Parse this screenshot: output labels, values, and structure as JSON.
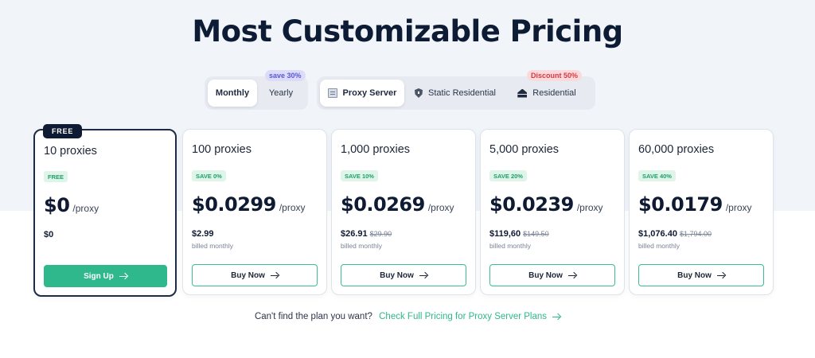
{
  "page": {
    "title": "Most Customizable Pricing"
  },
  "billing_toggle": {
    "options": [
      {
        "label": "Monthly",
        "active": true
      },
      {
        "label": "Yearly",
        "active": false
      }
    ],
    "badge": "save 30%"
  },
  "type_toggle": {
    "options": [
      {
        "label": "Proxy Server",
        "icon": "server-icon",
        "active": true
      },
      {
        "label": "Static Residential",
        "icon": "shield-icon",
        "active": false
      },
      {
        "label": "Residential",
        "icon": "home-icon",
        "active": false
      }
    ],
    "badge": "Discount 50%"
  },
  "plans": [
    {
      "tag": "FREE",
      "title": "10 proxies",
      "save": "FREE",
      "price": "$0",
      "unit": "/proxy",
      "total": "$0",
      "old": "",
      "billed": "",
      "button": "Sign Up"
    },
    {
      "title": "100 proxies",
      "save": "SAVE 0%",
      "price": "$0.0299",
      "unit": "/proxy",
      "total": "$2.99",
      "old": "",
      "billed": "billed monthly",
      "button": "Buy Now"
    },
    {
      "title": "1,000 proxies",
      "save": "SAVE 10%",
      "price": "$0.0269",
      "unit": "/proxy",
      "total": "$26.91",
      "old": "$29.90",
      "billed": "billed monthly",
      "button": "Buy Now"
    },
    {
      "title": "5,000 proxies",
      "save": "SAVE 20%",
      "price": "$0.0239",
      "unit": "/proxy",
      "total": "$119,60",
      "old": "$149.50",
      "billed": "billed monthly",
      "button": "Buy Now"
    },
    {
      "title": "60,000 proxies",
      "save": "SAVE 40%",
      "price": "$0.0179",
      "unit": "/proxy",
      "total": "$1,076.40",
      "old": "$1,794.00",
      "billed": "billed monthly",
      "button": "Buy Now"
    }
  ],
  "footer": {
    "text": "Can't find the plan you want?",
    "link": "Check Full Pricing for Proxy Server Plans"
  },
  "colors": {
    "accent": "#2fb88b",
    "dark": "#0f1b33",
    "save_badge": "#5a58d6",
    "discount_badge": "#d63a44"
  }
}
